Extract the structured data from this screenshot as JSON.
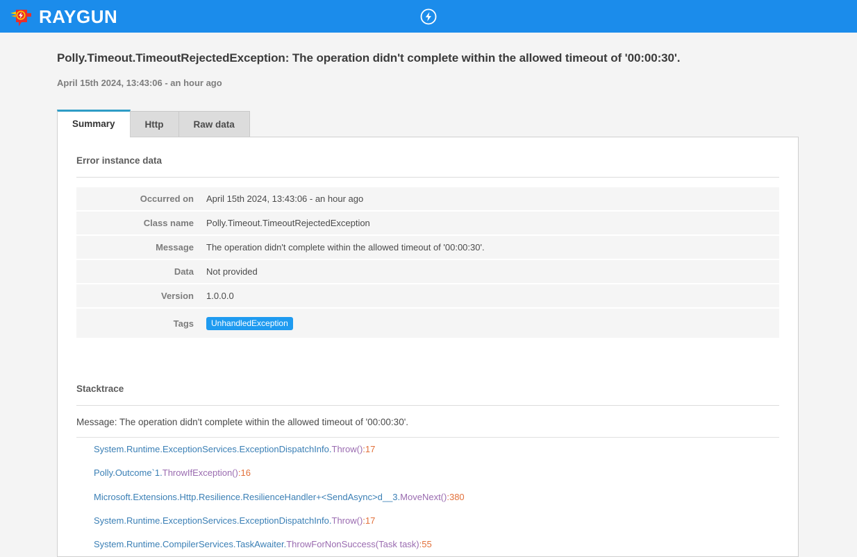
{
  "topbar": {
    "brand_name": "RAYGUN",
    "logo_icon": "raygun-logo-icon",
    "center_icon": "lightning-bolt-circle-icon"
  },
  "header": {
    "title": "Polly.Timeout.TimeoutRejectedException: The operation didn't complete within the allowed timeout of '00:00:30'.",
    "subtitle": "April 15th 2024, 13:43:06 - an hour ago"
  },
  "tabs": [
    {
      "label": "Summary",
      "active": true
    },
    {
      "label": "Http",
      "active": false
    },
    {
      "label": "Raw data",
      "active": false
    }
  ],
  "error_instance": {
    "section_title": "Error instance data",
    "rows": [
      {
        "label": "Occurred on",
        "value": "April 15th 2024, 13:43:06 - an hour ago"
      },
      {
        "label": "Class name",
        "value": "Polly.Timeout.TimeoutRejectedException"
      },
      {
        "label": "Message",
        "value": "The operation didn't complete within the allowed timeout of '00:00:30'."
      },
      {
        "label": "Data",
        "value": "Not provided"
      },
      {
        "label": "Version",
        "value": "1.0.0.0"
      }
    ],
    "tags_label": "Tags",
    "tags": [
      "UnhandledException"
    ]
  },
  "stacktrace": {
    "section_title": "Stacktrace",
    "message": "Message: The operation didn't complete within the allowed timeout of '00:00:30'.",
    "frames": [
      {
        "namespace": "System.Runtime.ExceptionServices.ExceptionDispatchInfo.",
        "method": "Throw()",
        "separator": ":",
        "line": "17"
      },
      {
        "namespace": "Polly.Outcome`1.",
        "method": "ThrowIfException()",
        "separator": ":",
        "line": "16"
      },
      {
        "namespace": "Microsoft.Extensions.Http.Resilience.ResilienceHandler+<SendAsync>d__3.",
        "method": "MoveNext()",
        "separator": ":",
        "line": "380"
      },
      {
        "namespace": "System.Runtime.ExceptionServices.ExceptionDispatchInfo.",
        "method": "Throw()",
        "separator": ":",
        "line": "17"
      },
      {
        "namespace": "System.Runtime.CompilerServices.TaskAwaiter.",
        "method": "ThrowForNonSuccess(Task task)",
        "separator": ":",
        "line": "55"
      }
    ]
  },
  "colors": {
    "brand_blue": "#1b8ceb",
    "accent_tab": "#2e9cc6",
    "tag_badge": "#1f9bf0",
    "stack_namespace": "#3a7fb5",
    "stack_method": "#9a6bb0",
    "stack_line_number": "#e2703a"
  }
}
